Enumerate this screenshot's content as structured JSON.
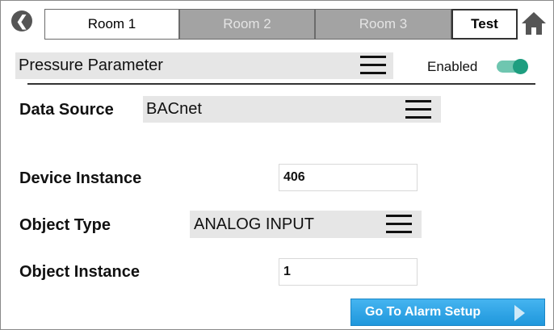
{
  "tabs": [
    {
      "label": "Room 1",
      "state": "active"
    },
    {
      "label": "Room 2",
      "state": "inactive"
    },
    {
      "label": "Room 3",
      "state": "inactive"
    },
    {
      "label": "Test",
      "state": "test"
    }
  ],
  "parameter": {
    "title": "Pressure Parameter",
    "enabled_label": "Enabled",
    "enabled": true
  },
  "data_source": {
    "label": "Data Source",
    "value": "BACnet"
  },
  "device_instance": {
    "label": "Device Instance",
    "value": "406"
  },
  "object_type": {
    "label": "Object Type",
    "value": "ANALOG INPUT"
  },
  "object_instance": {
    "label": "Object Instance",
    "value": "1"
  },
  "alarm_button": {
    "label": "Go To Alarm Setup"
  },
  "colors": {
    "toggle_on": "#1e9e80",
    "button": "#2aa3e6",
    "inactive_tab": "#a3a3a3"
  }
}
